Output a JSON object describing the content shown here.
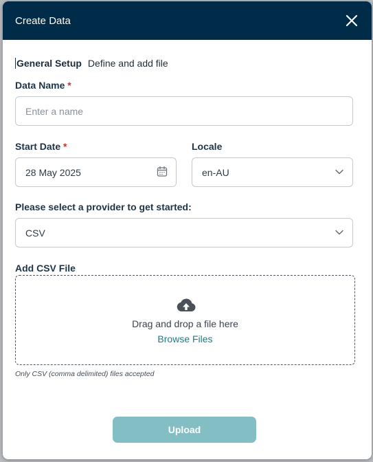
{
  "dialog": {
    "title": "Create Data"
  },
  "tabs": [
    {
      "label": "General Setup"
    },
    {
      "label": "Define and add file"
    }
  ],
  "data_name": {
    "label": "Data Name",
    "required_mark": "*",
    "placeholder": "Enter a name",
    "value": ""
  },
  "start_date": {
    "label": "Start Date",
    "required_mark": "*",
    "value": "28 May 2025"
  },
  "locale": {
    "label": "Locale",
    "value": "en-AU"
  },
  "provider": {
    "label": "Please select a provider to get started:",
    "value": "CSV"
  },
  "file_upload": {
    "label": "Add CSV File",
    "drag_text": "Drag and drop a file here",
    "browse_label": "Browse Files",
    "hint": "Only CSV (comma delimited) files accepted"
  },
  "upload_button": {
    "label": "Upload"
  },
  "colors": {
    "header_bg": "#002b49",
    "accent_link": "#1b7c87",
    "upload_button_bg": "#82bec3",
    "required": "#d32f2f"
  }
}
